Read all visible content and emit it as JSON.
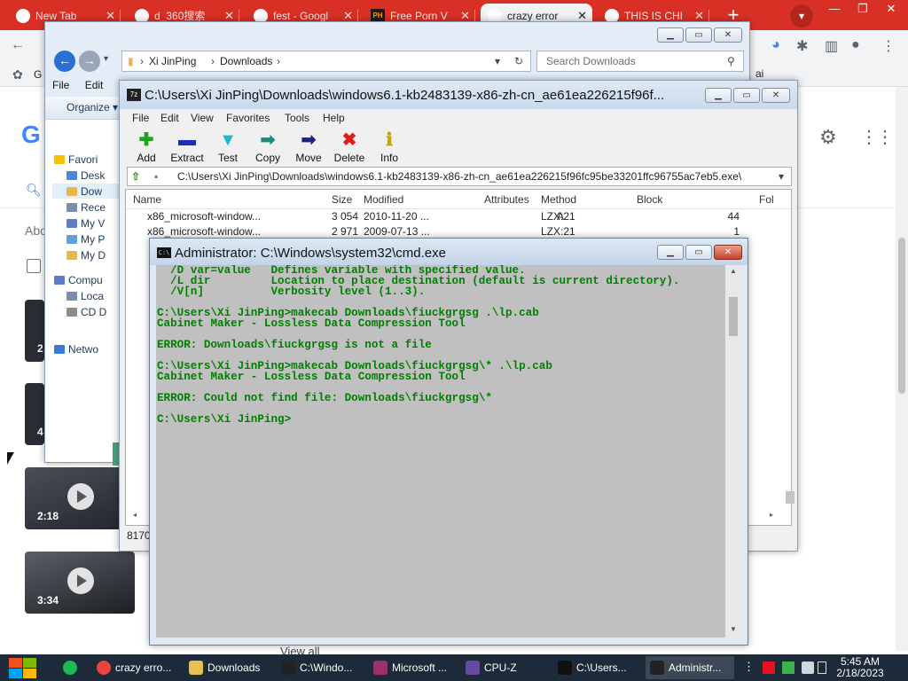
{
  "chrome": {
    "tabs": [
      {
        "label": "New Tab",
        "active": false
      },
      {
        "label": "d_360搜索",
        "active": false
      },
      {
        "label": "fest - Googl",
        "active": false
      },
      {
        "label": "Free Porn V",
        "active": false
      },
      {
        "label": "crazy error",
        "active": true
      },
      {
        "label": "THIS IS CHI",
        "active": false
      }
    ],
    "new_tab": "+",
    "bookmark_partial": "G",
    "side_text": "ai",
    "view_all": "View all"
  },
  "video_durations": [
    "2:18",
    "3:34"
  ],
  "side_thumb_counts": [
    "2",
    "4"
  ],
  "explorer": {
    "breadcrumb": [
      "Xi JinPing",
      "Downloads"
    ],
    "search_placeholder": "Search Downloads",
    "menu": [
      "File",
      "Edit"
    ],
    "organize": "Organize",
    "sidebar": [
      {
        "label": "Favori",
        "icon": "star-icon"
      },
      {
        "label": "Desk",
        "icon": "desktop-icon"
      },
      {
        "label": "Dow",
        "icon": "downloads-icon"
      },
      {
        "label": "Rece",
        "icon": "recent-icon"
      },
      {
        "label": "My V",
        "icon": "videos-icon"
      },
      {
        "label": "My P",
        "icon": "pictures-icon"
      },
      {
        "label": "My D",
        "icon": "documents-icon"
      },
      {
        "label": "Compu",
        "icon": "computer-icon"
      },
      {
        "label": "Loca",
        "icon": "drive-icon"
      },
      {
        "label": "CD D",
        "icon": "cd-icon"
      },
      {
        "label": "Netwo",
        "icon": "network-icon"
      }
    ]
  },
  "sevenzip": {
    "title": "C:\\Users\\Xi JinPing\\Downloads\\windows6.1-kb2483139-x86-zh-cn_ae61ea226215f96f...",
    "menu": [
      "File",
      "Edit",
      "View",
      "Favorites",
      "Tools",
      "Help"
    ],
    "tools": [
      {
        "label": "Add",
        "icon": "add-icon",
        "glyph": "✚",
        "color": "#1fa21f"
      },
      {
        "label": "Extract",
        "icon": "extract-icon",
        "glyph": "▬",
        "color": "#1a2fbf"
      },
      {
        "label": "Test",
        "icon": "test-icon",
        "glyph": "▼",
        "color": "#20b8c8"
      },
      {
        "label": "Copy",
        "icon": "copy-icon",
        "glyph": "➡",
        "color": "#1d8a7a"
      },
      {
        "label": "Move",
        "icon": "move-icon",
        "glyph": "➡",
        "color": "#1a237e"
      },
      {
        "label": "Delete",
        "icon": "delete-icon",
        "glyph": "✖",
        "color": "#e11a1a"
      },
      {
        "label": "Info",
        "icon": "info-icon",
        "glyph": "ℹ",
        "color": "#c9a400"
      }
    ],
    "path": "C:\\Users\\Xi JinPing\\Downloads\\windows6.1-kb2483139-x86-zh-cn_ae61ea226215f96fc95be33201ffc96755ac7eb5.exe\\",
    "columns": [
      "Name",
      "Size",
      "Modified",
      "Attributes",
      "Method",
      "Block",
      "Fol"
    ],
    "rows": [
      {
        "name": "x86_microsoft-window...",
        "size": "3 054",
        "modified": "2010-11-20 ...",
        "attributes": "A",
        "method": "LZX:21",
        "block": "44"
      },
      {
        "name": "x86_microsoft-window...",
        "size": "2 971",
        "modified": "2009-07-13 ...",
        "attributes": "",
        "method": "LZX:21",
        "block": "1"
      }
    ],
    "status": "8170"
  },
  "cmd": {
    "title": "Administrator: C:\\Windows\\system32\\cmd.exe",
    "lines": [
      "  /D var=value   Defines variable with specified value.",
      "  /L dir         Location to place destination (default is current directory).",
      "  /V[n]          Verbosity level (1..3).",
      "",
      "C:\\Users\\Xi JinPing>makecab Downloads\\fiuckgrgsg .\\lp.cab",
      "Cabinet Maker - Lossless Data Compression Tool",
      "",
      "ERROR: Downloads\\fiuckgrgsg is not a file",
      "",
      "C:\\Users\\Xi JinPing>makecab Downloads\\fiuckgrgsg\\* .\\lp.cab",
      "Cabinet Maker - Lossless Data Compression Tool",
      "",
      "ERROR: Could not find file: Downloads\\fiuckgrgsg\\*",
      "",
      "C:\\Users\\Xi JinPing>"
    ]
  },
  "taskbar": {
    "items": [
      {
        "label": "crazy erro...",
        "icon": "chrome-icon",
        "color": "#e8453c",
        "active": false
      },
      {
        "label": "Downloads",
        "icon": "folder-icon",
        "color": "#e6c14f",
        "active": false
      },
      {
        "label": "C:\\Windo...",
        "icon": "cmd-icon",
        "color": "#222222",
        "active": false
      },
      {
        "label": "Microsoft ...",
        "icon": "edge-icon",
        "color": "#9c2f6e",
        "active": false
      },
      {
        "label": "CPU-Z",
        "icon": "cpuz-icon",
        "color": "#6a4aa0",
        "active": false
      },
      {
        "label": "C:\\Users...",
        "icon": "7zip-icon",
        "color": "#111111",
        "active": false
      },
      {
        "label": "Administr...",
        "icon": "cmd-icon",
        "color": "#222222",
        "active": true
      }
    ],
    "time": "5:45 AM",
    "date": "2/18/2023"
  }
}
